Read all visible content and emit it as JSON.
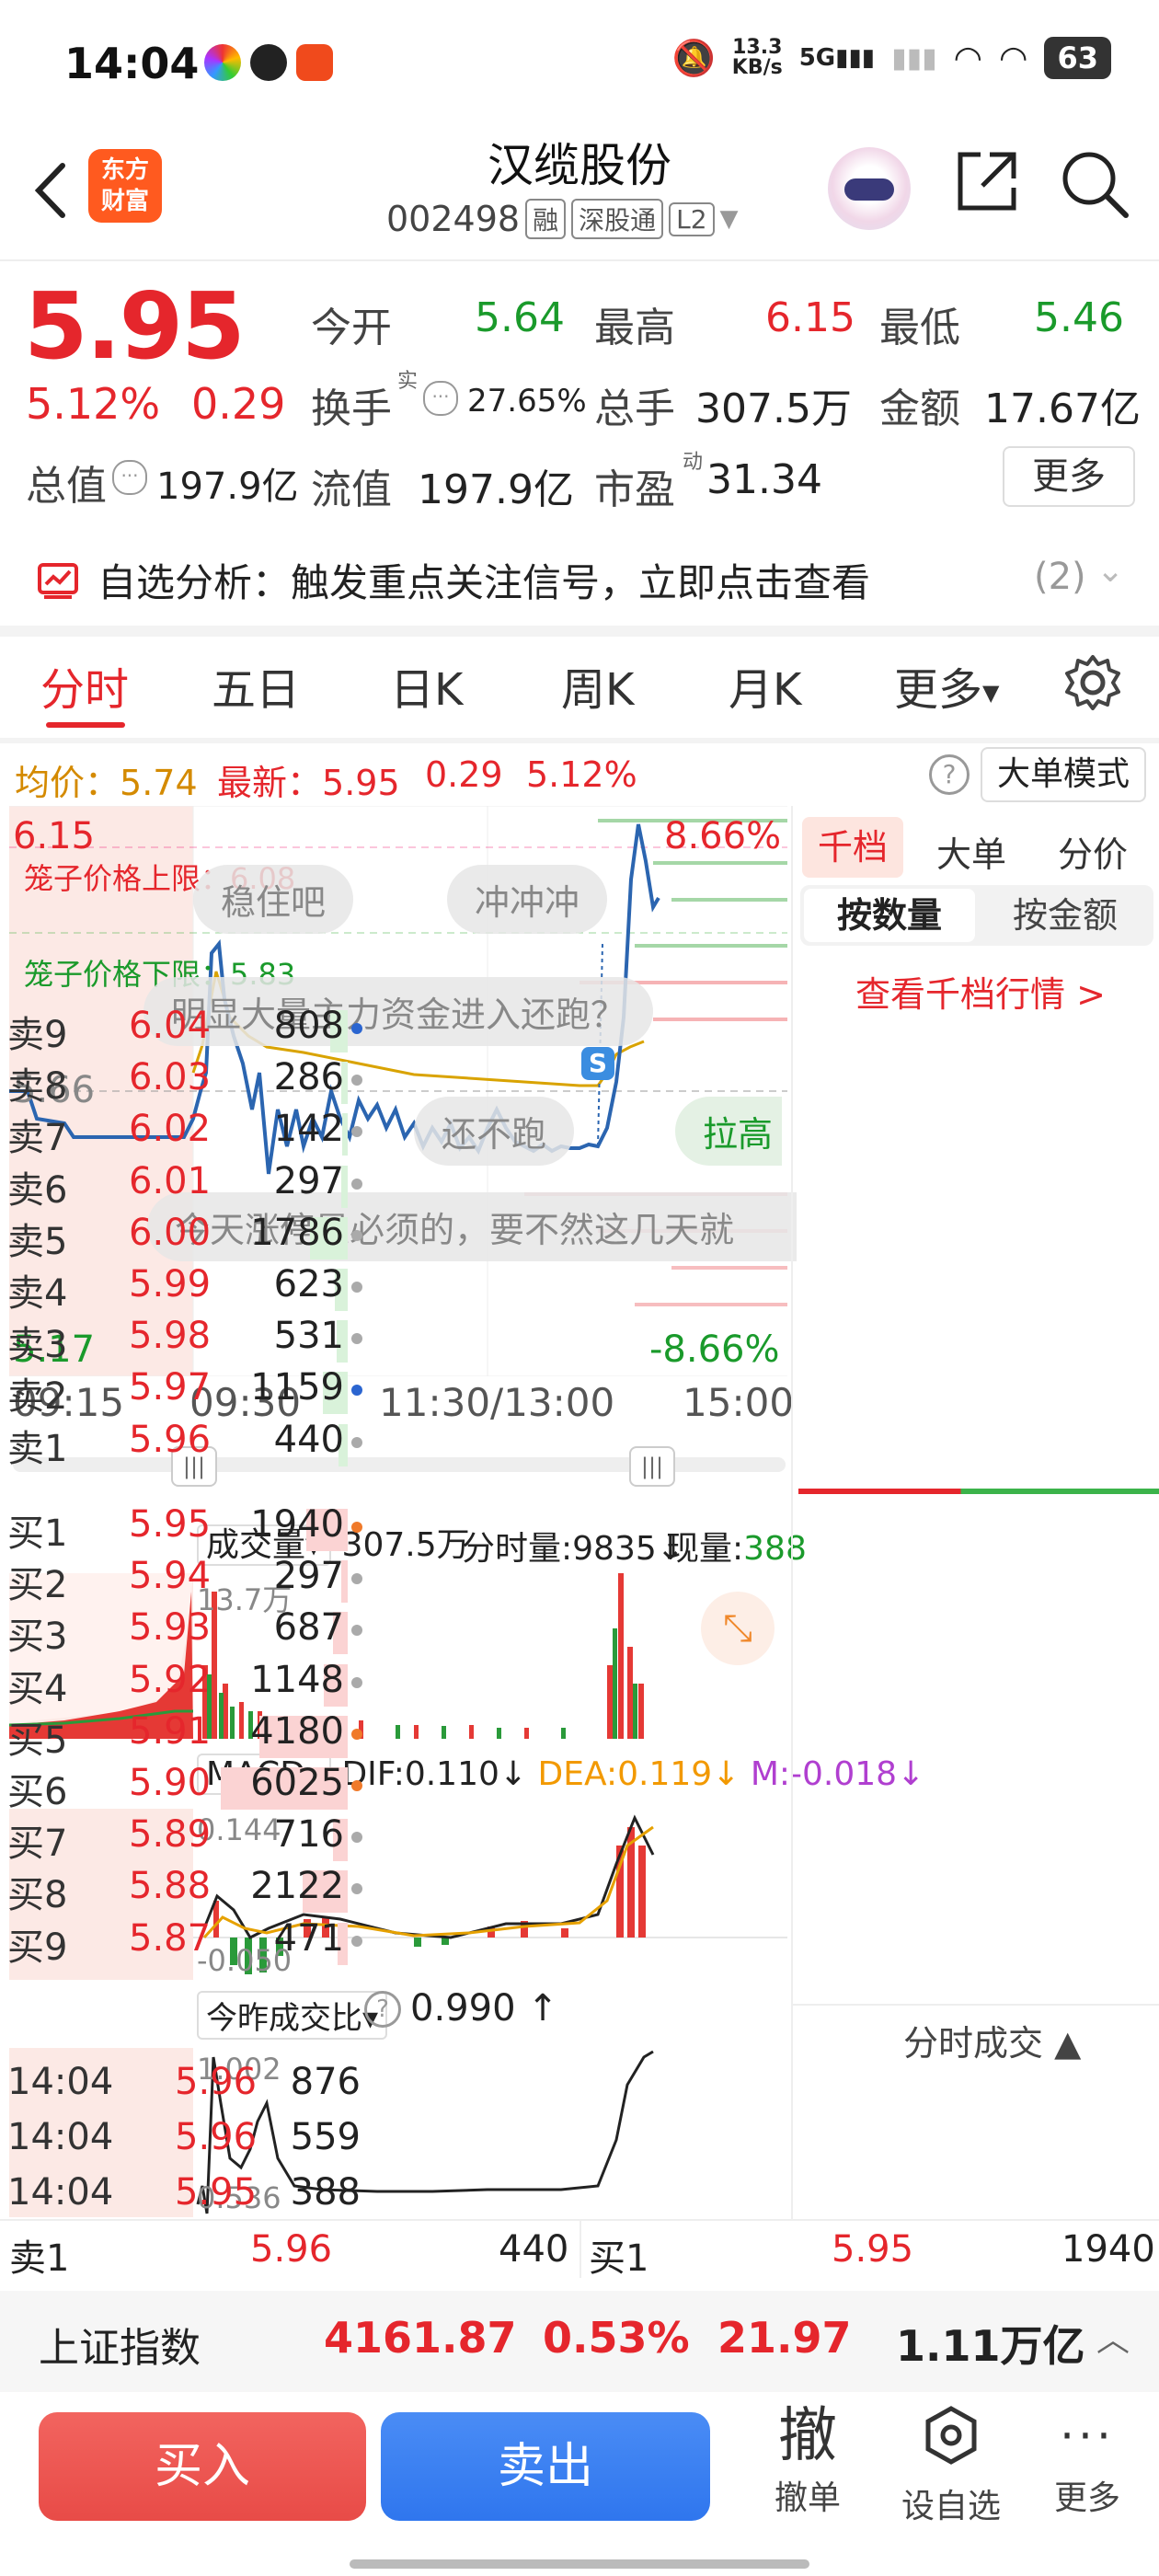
{
  "status_bar": {
    "time": "14:04",
    "net_speed_top": "13.3",
    "net_speed_bottom": "KB/s",
    "signal": "5G",
    "battery": "63"
  },
  "header": {
    "logo_top": "东方",
    "logo_bottom": "财富",
    "stock_name": "汉缆股份",
    "stock_code": "002498",
    "tags": [
      "融",
      "深股通",
      "L2"
    ]
  },
  "quote": {
    "price": "5.95",
    "change_pct": "5.12%",
    "change": "0.29",
    "open_label": "今开",
    "open": "5.64",
    "high_label": "最高",
    "high": "6.15",
    "low_label": "最低",
    "low": "5.46",
    "turnover_label": "换手",
    "turnover_sup": "实",
    "turnover": "27.65%",
    "volume_label": "总手",
    "volume": "307.5万",
    "amount_label": "金额",
    "amount": "17.67亿",
    "mktcap_label": "总值",
    "mktcap": "197.9亿",
    "float_label": "流值",
    "float_cap": "197.9亿",
    "pe_label": "市盈",
    "pe_sup": "动",
    "pe": "31.34",
    "more": "更多"
  },
  "analysis": {
    "text": "自选分析：触发重点关注信号，立即点击查看",
    "count": "(2)"
  },
  "tabs": [
    "分时",
    "五日",
    "日K",
    "周K",
    "月K",
    "更多"
  ],
  "infobar": {
    "avg_label": "均价：",
    "avg": "5.74",
    "latest_label": "最新：",
    "latest": "5.95",
    "chg": "0.29",
    "pct": "5.12%",
    "big_mode": "大单模式"
  },
  "chart": {
    "price_high": "6.15",
    "price_low": "5.17",
    "price_mid": "5.66",
    "pct_high": "8.66%",
    "pct_low": "-8.66%",
    "upper_limit": "笼子价格上限：6.08",
    "lower_limit": "笼子价格下限：5.83",
    "badge": "S",
    "bubbles": [
      "稳住吧",
      "冲冲冲",
      "明显大量主力资金进入还跑？",
      "还不跑",
      "拉高",
      "今天涨停是必须的，要不然这几天就"
    ],
    "times": [
      "09:15",
      "09:30",
      "11:30/13:00",
      "15:00"
    ]
  },
  "volume_panel": {
    "selector": "成交量",
    "total": "307.5万",
    "tick_label": "分时量:",
    "tick_val": "9835",
    "now_label": "现量:",
    "now_val": "388",
    "max": "13.7万"
  },
  "macd_panel": {
    "selector": "MACD",
    "dif": "DIF:0.110",
    "dea": "DEA:0.119",
    "m": "M:-0.018",
    "top": "0.144",
    "bottom": "-0.050"
  },
  "ratio_panel": {
    "selector": "今昨成交比",
    "value": "0.990",
    "top": "1.002",
    "bottom": "0.536"
  },
  "orderbook": {
    "tabs": [
      "千档",
      "大单",
      "分价"
    ],
    "sub_tabs": [
      "按数量",
      "按金额"
    ],
    "link": "查看千档行情 >",
    "sells": [
      {
        "label": "卖9",
        "price": "6.04",
        "vol": "808"
      },
      {
        "label": "卖8",
        "price": "6.03",
        "vol": "286"
      },
      {
        "label": "卖7",
        "price": "6.02",
        "vol": "142"
      },
      {
        "label": "卖6",
        "price": "6.01",
        "vol": "297"
      },
      {
        "label": "卖5",
        "price": "6.00",
        "vol": "1786"
      },
      {
        "label": "卖4",
        "price": "5.99",
        "vol": "623"
      },
      {
        "label": "卖3",
        "price": "5.98",
        "vol": "531"
      },
      {
        "label": "卖2",
        "price": "5.97",
        "vol": "1159"
      },
      {
        "label": "卖1",
        "price": "5.96",
        "vol": "440"
      }
    ],
    "buys": [
      {
        "label": "买1",
        "price": "5.95",
        "vol": "1940"
      },
      {
        "label": "买2",
        "price": "5.94",
        "vol": "297"
      },
      {
        "label": "买3",
        "price": "5.93",
        "vol": "687"
      },
      {
        "label": "买4",
        "price": "5.92",
        "vol": "1148"
      },
      {
        "label": "买5",
        "price": "5.91",
        "vol": "4180"
      },
      {
        "label": "买6",
        "price": "5.90",
        "vol": "6025"
      },
      {
        "label": "买7",
        "price": "5.89",
        "vol": "716"
      },
      {
        "label": "买8",
        "price": "5.88",
        "vol": "2122"
      },
      {
        "label": "买9",
        "price": "5.87",
        "vol": "471"
      }
    ],
    "ticks_title": "分时成交",
    "ticks": [
      {
        "time": "14:04",
        "price": "5.96",
        "vol": "876"
      },
      {
        "time": "14:04",
        "price": "5.96",
        "vol": "559"
      },
      {
        "time": "14:04",
        "price": "5.95",
        "vol": "388"
      }
    ]
  },
  "bottom_quote": {
    "sell_label": "卖1",
    "sell_price": "5.96",
    "sell_vol": "440",
    "buy_label": "买1",
    "buy_price": "5.95",
    "buy_vol": "1940"
  },
  "index_bar": {
    "name": "上证指数",
    "value": "4161.87",
    "pct": "0.53%",
    "chg": "21.97",
    "amount": "1.11万亿"
  },
  "actions": {
    "buy": "买入",
    "sell": "卖出",
    "cancel_icon": "撤",
    "cancel": "撤单",
    "watch": "设自选",
    "more": "更多"
  }
}
